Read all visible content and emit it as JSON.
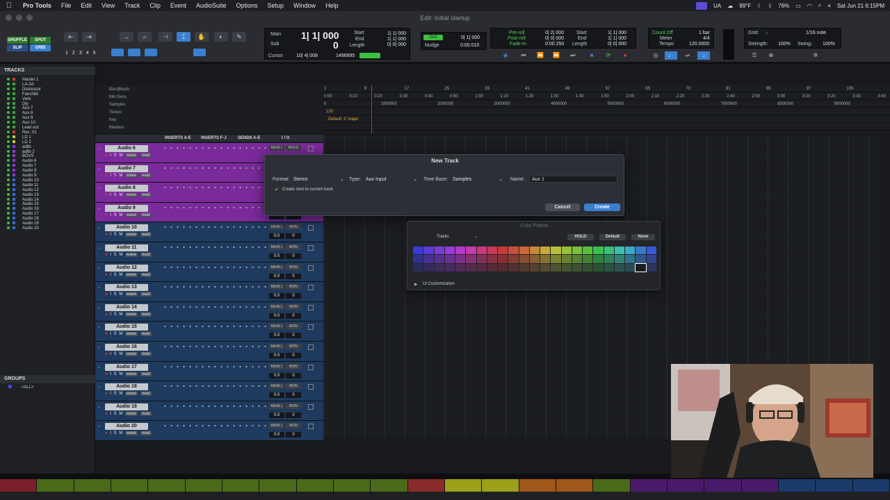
{
  "menubar": {
    "app_name": "Pro Tools",
    "items": [
      "File",
      "Edit",
      "View",
      "Track",
      "Clip",
      "Event",
      "AudioSuite",
      "Options",
      "Setup",
      "Window",
      "Help"
    ],
    "status_ua": "UA",
    "temperature": "99°F",
    "battery": "76%",
    "datetime": "Sat Jun 21  6:15PM"
  },
  "window": {
    "title": "Edit: Initial startup"
  },
  "toolbar": {
    "modes": [
      "SHUFFLE",
      "SPOT",
      "SLIP",
      "GRID"
    ],
    "zoom_presets": [
      "1",
      "2",
      "3",
      "4",
      "5"
    ],
    "counter": {
      "main_label": "Main",
      "main_value": "1| 1| 000",
      "sub_label": "Sub",
      "sub_value": "0",
      "start_label": "Start",
      "end_label": "End",
      "length_label": "Length",
      "start_value": "1| 1| 000",
      "end_value": "1| 1| 000",
      "length_value": "0| 0| 000",
      "cursor_label": "Cursor",
      "cursor_value": "10| 4| 008",
      "samples_value": "1496895"
    },
    "nudge": {
      "grid_label": "Grid",
      "grid_value": "0| 1| 000",
      "nudge_label": "Nudge",
      "nudge_value": "0:00.010"
    },
    "prepost": {
      "preroll_label": "Pre-roll",
      "preroll_value": "0| 2| 000",
      "postroll_label": "Post-roll",
      "postroll_value": "0| 0| 000",
      "fadein_label": "Fade-in",
      "fadein_value": "0:00.250",
      "start_label": "Start",
      "start_value": "1| 1| 000",
      "end_label": "End",
      "end_value": "1| 1| 000",
      "length_label": "Length",
      "length_value": "0| 0| 000"
    },
    "meter": {
      "countoff_label": "Count Off",
      "countoff_value": "1 bar",
      "meter_label": "Meter",
      "meter_value": "4/4",
      "tempo_label": "Tempo",
      "tempo_value": "120.0000"
    },
    "grid_settings": {
      "grid_label": "Grid:",
      "grid_value": "1/16 note",
      "strength_label": "Strength:",
      "strength_value": "100%",
      "swing_label": "Swing:",
      "swing_value": "100%"
    }
  },
  "tracks_panel": {
    "title": "TRACKS",
    "items": [
      {
        "name": "Master 1",
        "color": "#d23a3a"
      },
      {
        "name": "LA-2A",
        "color": "#3fa03f"
      },
      {
        "name": "Distressor",
        "color": "#3fa03f"
      },
      {
        "name": "Fairchild",
        "color": "#3fa03f"
      },
      {
        "name": "Verb",
        "color": "#3fa03f"
      },
      {
        "name": "Dly",
        "color": "#3fa03f"
      },
      {
        "name": "Aux 7",
        "color": "#3fa03f"
      },
      {
        "name": "Aux 8",
        "color": "#3fa03f"
      },
      {
        "name": "Aux 9",
        "color": "#3fa03f"
      },
      {
        "name": "Aux 10",
        "color": "#3fa03f"
      },
      {
        "name": "Lead out",
        "color": "#3fa03f"
      },
      {
        "name": "Rec .01",
        "color": "#d23a3a"
      },
      {
        "name": "LD 1",
        "color": "#c8c83a"
      },
      {
        "name": "LD 2",
        "color": "#c8c83a"
      },
      {
        "name": "adlib",
        "color": "#8a3ad2"
      },
      {
        "name": "adlib 2",
        "color": "#8a3ad2"
      },
      {
        "name": "BGVS",
        "color": "#8a3ad2"
      },
      {
        "name": "Audio 6",
        "color": "#8a3ad2"
      },
      {
        "name": "Audio 7",
        "color": "#8a3ad2"
      },
      {
        "name": "Audio 8",
        "color": "#8a3ad2"
      },
      {
        "name": "Audio 9",
        "color": "#8a3ad2"
      },
      {
        "name": "Audio 10",
        "color": "#3a6ad2"
      },
      {
        "name": "Audio 11",
        "color": "#3a6ad2"
      },
      {
        "name": "Audio 12",
        "color": "#3a6ad2"
      },
      {
        "name": "Audio 13",
        "color": "#3a6ad2"
      },
      {
        "name": "Audio 14",
        "color": "#3a6ad2"
      },
      {
        "name": "Audio 15",
        "color": "#3a6ad2"
      },
      {
        "name": "Audio 16",
        "color": "#3a6ad2"
      },
      {
        "name": "Audio 17",
        "color": "#3a6ad2"
      },
      {
        "name": "Audio 18",
        "color": "#3a6ad2"
      },
      {
        "name": "Audio 19",
        "color": "#3a6ad2"
      },
      {
        "name": "Audio 20",
        "color": "#3a6ad2"
      }
    ]
  },
  "groups_panel": {
    "title": "GROUPS",
    "all_label": "<ALL>"
  },
  "rulers": {
    "labels": [
      "Bars|Beats",
      "Min:Secs",
      "Samples",
      "Tempo",
      "Key",
      "Markers"
    ],
    "bars": [
      "1",
      "9",
      "17",
      "25",
      "33",
      "41",
      "49",
      "57",
      "65",
      "73",
      "81",
      "89",
      "97",
      "105"
    ],
    "minsecs": [
      "0:00",
      "0:10",
      "0:20",
      "0:30",
      "0:40",
      "0:50",
      "1:00",
      "1:10",
      "1:20",
      "1:30",
      "1:40",
      "1:50",
      "2:00",
      "2:10",
      "2:20",
      "2:30",
      "2:40",
      "2:50",
      "3:00",
      "3:10",
      "3:20",
      "3:30",
      "3:40"
    ],
    "samples": [
      "0",
      "1000000",
      "2000000",
      "3000000",
      "4000000",
      "5000000",
      "6000000",
      "7000000",
      "8000000",
      "9000000"
    ],
    "tempo_value": "120",
    "key_value": "Default: C major"
  },
  "track_header": {
    "inserts_ae": "INSERTS A-E",
    "inserts_fj": "INSERTS F-J",
    "sends_ae": "SENDS A-E",
    "io": "I / O"
  },
  "tracks": [
    {
      "name": "Audio 6",
      "color": "#7a2a9a",
      "input": "MicIN L",
      "output": "BGVS",
      "vol": "",
      "pan": ""
    },
    {
      "name": "Audio 7",
      "color": "#7a2a9a",
      "input": "",
      "output": "",
      "vol": "",
      "pan": ""
    },
    {
      "name": "Audio 8",
      "color": "#7a2a9a",
      "input": "",
      "output": "",
      "vol": "",
      "pan": ""
    },
    {
      "name": "Audio 9",
      "color": "#7a2a9a",
      "input": "",
      "output": "",
      "vol": "",
      "pan": ""
    },
    {
      "name": "Audio 10",
      "color": "#1e3a5e",
      "input": "MicIN L",
      "output": "MON",
      "vol": "0.0",
      "pan": "0"
    },
    {
      "name": "Audio 11",
      "color": "#1e3a5e",
      "input": "MicIN L",
      "output": "MON",
      "vol": "0.0",
      "pan": "0"
    },
    {
      "name": "Audio 12",
      "color": "#1e3a5e",
      "input": "MicIN L",
      "output": "MON",
      "vol": "0.0",
      "pan": "0"
    },
    {
      "name": "Audio 13",
      "color": "#1e3a5e",
      "input": "MicIN L",
      "output": "MON",
      "vol": "0.0",
      "pan": "0"
    },
    {
      "name": "Audio 14",
      "color": "#1e3a5e",
      "input": "MicIN L",
      "output": "MON",
      "vol": "0.0",
      "pan": "0"
    },
    {
      "name": "Audio 15",
      "color": "#1e3a5e",
      "input": "MicIN L",
      "output": "MON",
      "vol": "0.0",
      "pan": "0"
    },
    {
      "name": "Audio 16",
      "color": "#1e3a5e",
      "input": "MicIN L",
      "output": "MON",
      "vol": "0.0",
      "pan": "0"
    },
    {
      "name": "Audio 17",
      "color": "#1e3a5e",
      "input": "MicIN L",
      "output": "MON",
      "vol": "0.0",
      "pan": "0"
    },
    {
      "name": "Audio 18",
      "color": "#1e3a5e",
      "input": "MicIN L",
      "output": "MON",
      "vol": "0.0",
      "pan": "0"
    },
    {
      "name": "Audio 19",
      "color": "#1e3a5e",
      "input": "MicIN L",
      "output": "MON",
      "vol": "0.0",
      "pan": "0"
    },
    {
      "name": "Audio 20",
      "color": "#1e3a5e",
      "input": "MicIN L",
      "output": "MON",
      "vol": "0.0",
      "pan": "0"
    }
  ],
  "track_buttons": {
    "rec": "●",
    "input": "I",
    "solo": "S",
    "mute": "M",
    "wave": "wave",
    "read": "read"
  },
  "new_track_dialog": {
    "title": "New Track",
    "format_label": "Format:",
    "format_value": "Stereo",
    "type_label": "Type:",
    "type_value": "Aux Input",
    "timebase_label": "Time Base:",
    "timebase_value": "Samples",
    "name_label": "Name:",
    "name_value": "Aux 1",
    "checkbox_label": "Create next to current track",
    "cancel": "Cancel",
    "create": "Create"
  },
  "color_palette": {
    "title": "Color Palette",
    "target": "Tracks",
    "hold": "HOLD",
    "default": "Default",
    "none": "None",
    "ui_customization": "UI Customization"
  },
  "colors": {
    "accent": "#3a7fd0",
    "purple_track": "#7a2a9a",
    "blue_track": "#1e3a5e"
  }
}
